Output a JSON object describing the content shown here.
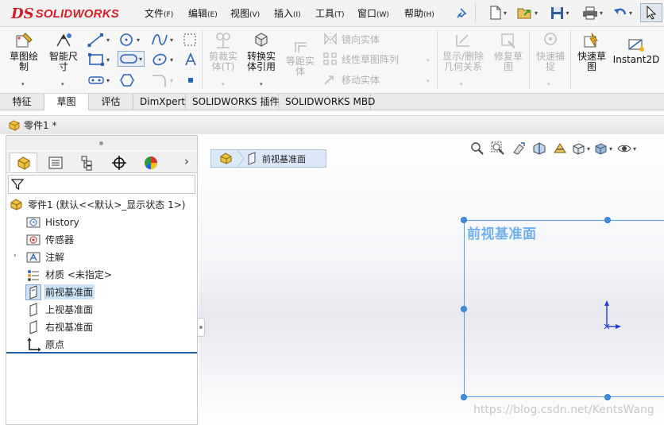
{
  "app": {
    "logo_prefix": "DS",
    "logo_text": "SOLIDWORKS"
  },
  "menu": [
    {
      "label": "文件",
      "key": "(F)"
    },
    {
      "label": "编辑",
      "key": "(E)"
    },
    {
      "label": "视图",
      "key": "(V)"
    },
    {
      "label": "插入",
      "key": "(I)"
    },
    {
      "label": "工具",
      "key": "(T)"
    },
    {
      "label": "窗口",
      "key": "(W)"
    },
    {
      "label": "帮助",
      "key": "(H)"
    }
  ],
  "ribbon": {
    "sketch": "草图绘\n制",
    "smart_dim": "智能尺\n寸",
    "trim": "剪裁实\n体(T)",
    "convert": "转换实\n体引用",
    "offset": "等距实\n体",
    "mirror": "镜向实体",
    "linear_pattern": "线性草图阵列",
    "move": "移动实体",
    "display_delete": "显示/删除\n几何关系",
    "repair": "修复草\n图",
    "quick_snap": "快速捕\n捉",
    "rapid_sketch": "快速草\n图",
    "instant2d": "Instant2D"
  },
  "tabs": [
    "特征",
    "草图",
    "评估",
    "DimXpert",
    "SOLIDWORKS 插件",
    "SOLIDWORKS MBD"
  ],
  "active_tab": "草图",
  "document": {
    "title": "零件1 *"
  },
  "tree": {
    "root": "零件1  (默认<<默认>_显示状态 1>)",
    "items": [
      "History",
      "传感器",
      "注解",
      "材质 <未指定>",
      "前视基准面",
      "上视基准面",
      "右视基准面",
      "原点"
    ]
  },
  "breadcrumb": {
    "label": "前视基准面"
  },
  "plane_label": "前视基准面",
  "watermark": "https://blog.csdn.net/KentsWang",
  "colors": {
    "brand": "#d01f27",
    "selection": "#cde2f7",
    "plane": "#5aa0e8",
    "plane_label": "#70b0ee"
  }
}
